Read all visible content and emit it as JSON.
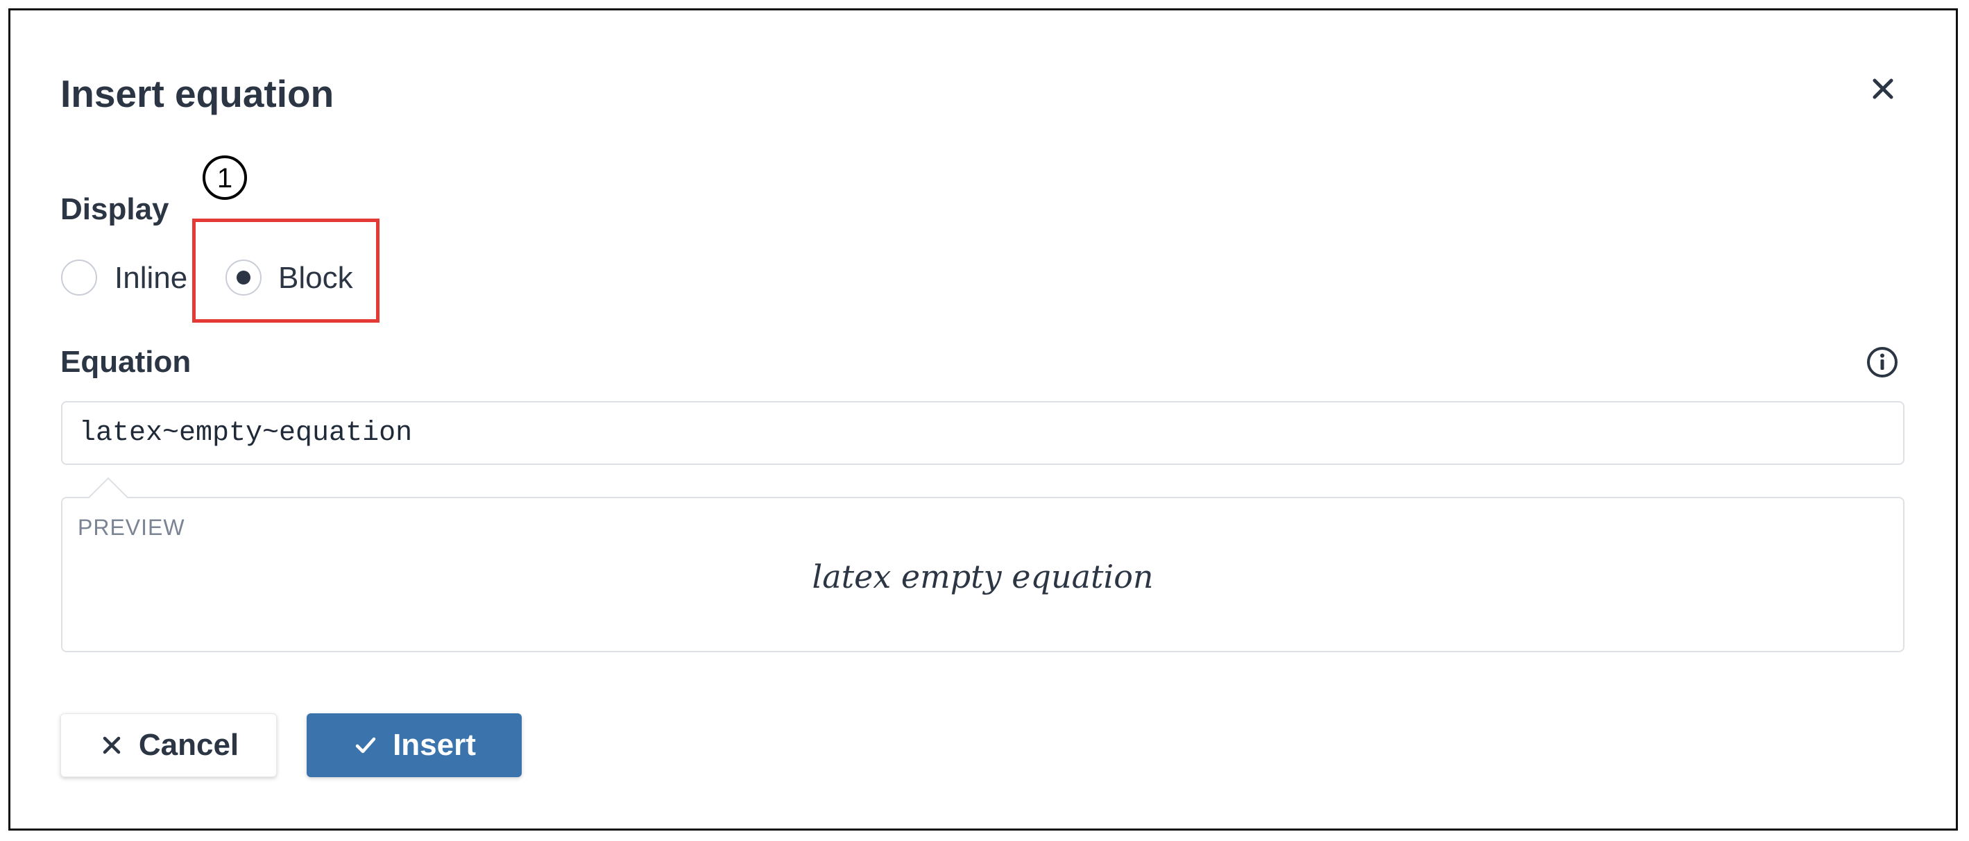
{
  "dialog": {
    "title": "Insert equation",
    "close_icon": "close-icon"
  },
  "annotation": {
    "number": "1",
    "highlight_color": "#e53935"
  },
  "display": {
    "label": "Display",
    "options": [
      {
        "label": "Inline",
        "selected": false
      },
      {
        "label": "Block",
        "selected": true
      }
    ]
  },
  "equation": {
    "label": "Equation",
    "info_icon": "info-icon",
    "value": "latex~empty~equation"
  },
  "preview": {
    "label": "PREVIEW",
    "rendered": "latex empty equation"
  },
  "actions": {
    "cancel_label": "Cancel",
    "cancel_icon": "close-icon",
    "insert_label": "Insert",
    "insert_icon": "check-icon",
    "insert_color": "#3b73ad"
  }
}
